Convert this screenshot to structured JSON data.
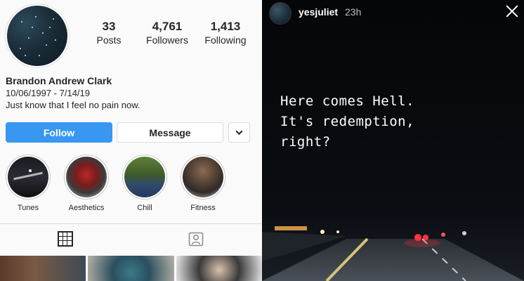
{
  "profile": {
    "stats": [
      {
        "value": "33",
        "label": "Posts"
      },
      {
        "value": "4,761",
        "label": "Followers"
      },
      {
        "value": "1,413",
        "label": "Following"
      }
    ],
    "name": "Brandon Andrew Clark",
    "dates": "10/06/1997 - 7/14/19",
    "bio": "Just know that I feel no pain now.",
    "follow_label": "Follow",
    "message_label": "Message",
    "highlights": [
      {
        "label": "Tunes"
      },
      {
        "label": "Aesthetics"
      },
      {
        "label": "Chill"
      },
      {
        "label": "Fitness"
      }
    ],
    "colors": {
      "accent": "#3897f0",
      "text": "#262626",
      "border": "#dbdbdb"
    }
  },
  "story": {
    "username": "yesjuliet",
    "time": "23h",
    "caption": "Here comes Hell.\nIt's redemption,\nright?"
  }
}
